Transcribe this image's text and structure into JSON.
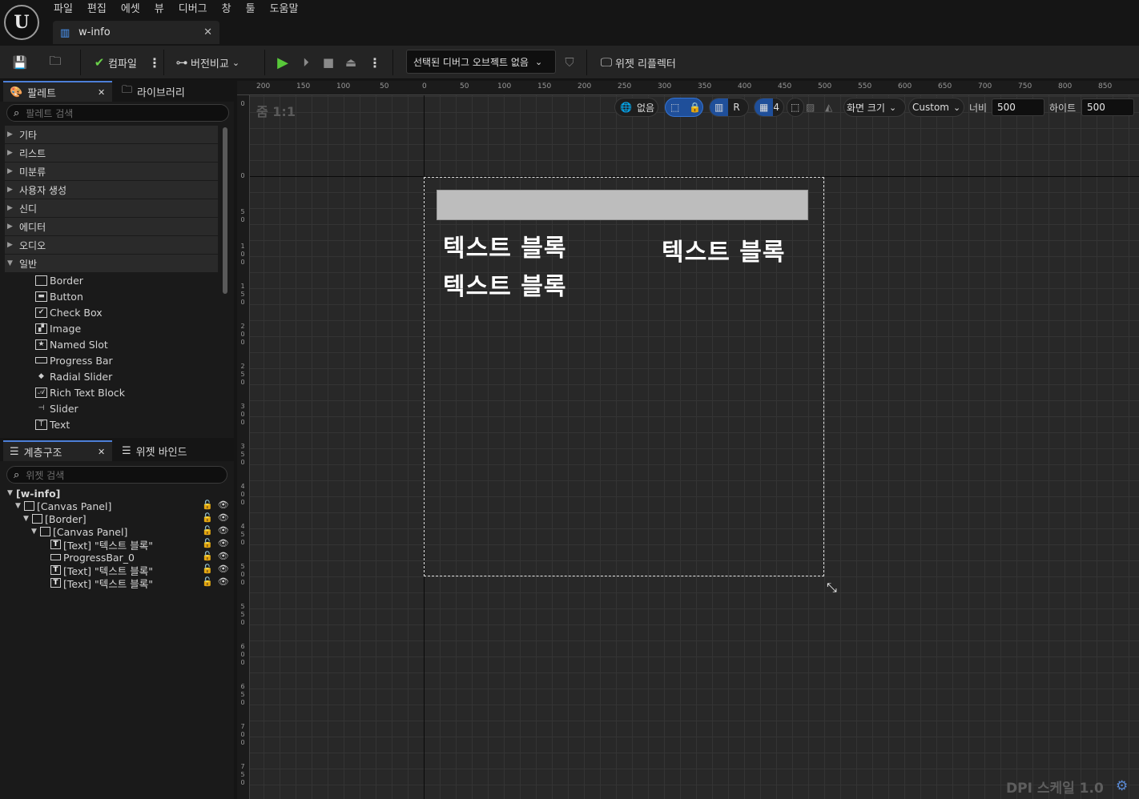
{
  "app": {
    "logo_text": "U",
    "menu": [
      "파일",
      "편집",
      "에셋",
      "뷰",
      "디버그",
      "창",
      "툴",
      "도움말"
    ],
    "doc_tab": "w-info"
  },
  "toolbar": {
    "compile": "컴파일",
    "version_compare": "버전비교",
    "debug_object": "선택된 디버그 오브젝트 없음",
    "widget_reflector": "위젯 리플렉터"
  },
  "palette": {
    "tab": "팔레트",
    "library_tab": "라이브러리",
    "search_placeholder": "팔레트 검색",
    "categories": [
      "기타",
      "리스트",
      "미분류",
      "사용자 생성",
      "신디",
      "에디터",
      "오디오",
      "일반"
    ],
    "items": [
      "Border",
      "Button",
      "Check Box",
      "Image",
      "Named Slot",
      "Progress Bar",
      "Radial Slider",
      "Rich Text Block",
      "Slider",
      "Text"
    ]
  },
  "hierarchy": {
    "tab": "계층구조",
    "binding_tab": "위젯 바인드",
    "search_placeholder": "위젯 검색",
    "items": [
      "[w-info]",
      "[Canvas Panel]",
      "[Border]",
      "[Canvas Panel]",
      "[Text] \"텍스트 블록\"",
      "ProgressBar_0",
      "[Text] \"텍스트 블록\"",
      "[Text] \"텍스트 블록\""
    ]
  },
  "viewport": {
    "zoom": "줌 1:1",
    "none_label": "없음",
    "r_label": "R",
    "grid_size": "4",
    "screen_size": "화면 크기",
    "custom": "Custom",
    "width_label": "너비",
    "width_value": "500",
    "height_label": "하이트",
    "height_value": "500",
    "dpi": "DPI 스케일 1.0",
    "ruler_top": [
      "200",
      "150",
      "100",
      "50",
      "0",
      "50",
      "100",
      "150",
      "200",
      "250",
      "300",
      "350",
      "400",
      "450",
      "500",
      "550",
      "600",
      "650",
      "700",
      "750",
      "800",
      "850"
    ],
    "ruler_left": [
      "0",
      "0",
      "50",
      "100",
      "150",
      "200",
      "250",
      "300",
      "350",
      "400",
      "450",
      "500",
      "550",
      "600",
      "650",
      "700",
      "750"
    ]
  },
  "design": {
    "text_blocks": [
      "텍스트 블록",
      "텍스트 블록",
      "텍스트 블록"
    ]
  }
}
